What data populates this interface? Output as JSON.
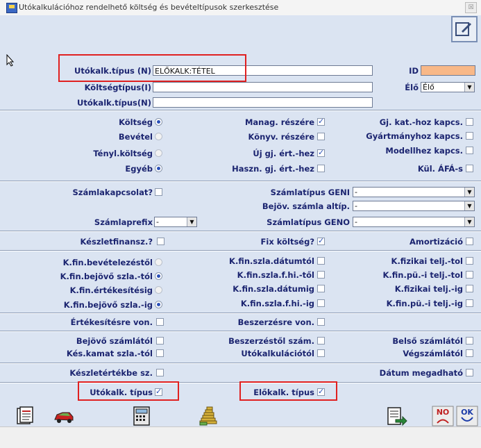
{
  "window": {
    "title": "Utókalkulációhoz rendelhető költség és bevételtípusok szerkesztése",
    "close_symbol": "☒"
  },
  "top": {
    "utokalk_tipus_label": "Utókalk.típus (N)",
    "utokalk_tipus_value": "ELŐKALK:TÉTEL",
    "koltsegtipus_label": "Költségtípus(I)",
    "koltsegtipus_value": "",
    "utokalk_tipus2_label": "Utókalk.típus(N)",
    "utokalk_tipus2_value": "",
    "id_label": "ID",
    "id_value": "",
    "elo_label": "Élő",
    "elo_value": "Élő"
  },
  "type_group": {
    "koltseg": {
      "label": "Költség",
      "selected": true
    },
    "bevetel": {
      "label": "Bevétel",
      "selected": false
    },
    "tenyl_koltseg": {
      "label": "Tényl.költség",
      "selected": false
    },
    "egyeb": {
      "label": "Egyéb",
      "selected": true
    }
  },
  "mid_checks": {
    "manag": {
      "label": "Manag. részére",
      "checked": true
    },
    "konyv": {
      "label": "Könyv. részére",
      "checked": false
    },
    "uj_gj": {
      "label": "Új gj. ért.-hez",
      "checked": true
    },
    "haszn_gj": {
      "label": "Haszn. gj. ért.-hez",
      "checked": false
    }
  },
  "right_checks": {
    "gj_kat": {
      "label": "Gj. kat.-hoz kapcs.",
      "checked": false
    },
    "gyartmany": {
      "label": "Gyártmányhoz kapcs.",
      "checked": false
    },
    "modell": {
      "label": "Modellhez kapcs.",
      "checked": false
    },
    "kul_afa": {
      "label": "Kül. ÁFÁ-s",
      "checked": false
    }
  },
  "szamla": {
    "kapcsolat_label": "Számlakapcsolat?",
    "tipus_geni_label": "Számlatípus GENI",
    "tipus_geni_value": "-",
    "bejov_altip_label": "Bejöv. számla altíp.",
    "bejov_altip_value": "-",
    "prefix_label": "Számlaprefix",
    "prefix_value": "-",
    "tipus_geno_label": "Számlatípus GENO",
    "tipus_geno_value": "-"
  },
  "finansz": {
    "keszlet_label": "Készletfinansz.?",
    "fix_label": "Fix költség?",
    "fix_checked": true,
    "amort_label": "Amortizáció"
  },
  "kfin_left": [
    {
      "label": "K.fin.bevételezéstől",
      "selected": false
    },
    {
      "label": "K.fin.bejövő szla.-tól",
      "selected": true
    },
    {
      "label": "K.fin.értékesítésig",
      "selected": false
    },
    {
      "label": "K.fin.bejövő szla.-ig",
      "selected": true
    }
  ],
  "kfin_mid": [
    "K.fin.szla.dátumtól",
    "K.fin.szla.f.hi.-től",
    "K.fin.szla.dátumig",
    "K.fin.szla.f.hi.-ig"
  ],
  "kfin_right": [
    "K.fizikai telj.-tol",
    "K.fin.pü.-i telj.-tol",
    "K.fizikai telj.-ig",
    "K.fin.pü.-i telj.-ig"
  ],
  "von": {
    "ertekesitesre": "Értékesítésre von.",
    "beszerzesre": "Beszerzésre von."
  },
  "szamlatol": {
    "bejovo": "Bejövő számlától",
    "beszerzestol": "Beszerzéstől szám.",
    "belso": "Belső számlától",
    "kes_kamat": "Kés.kamat szla.-tól",
    "utokalkulaciotol": "Utókalkulációtól",
    "vegszamlatol": "Végszámlától"
  },
  "keszletertek_label": "Készletértékbe sz.",
  "datum_label": "Dátum megadható",
  "bottom": {
    "utokalk_tipus_label": "Utókalk. típus",
    "elokalk_tipus_label": "Előkalk. típus"
  },
  "toolbar": {
    "no_label": "NO",
    "ok_label": "OK"
  },
  "colors": {
    "form_bg": "#dbe4f2",
    "label": "#1b2470",
    "highlight": "#e02020",
    "id_field": "#f8b888"
  }
}
